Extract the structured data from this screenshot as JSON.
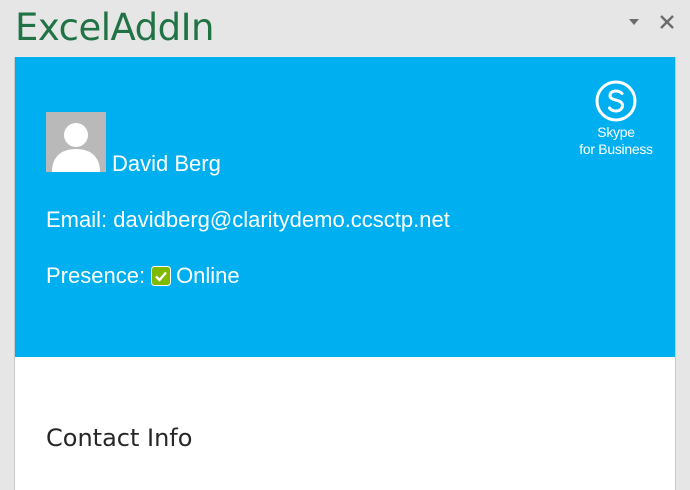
{
  "pane": {
    "title": "ExcelAddIn",
    "options_icon": "chevron-down-icon",
    "close_icon": "close-icon"
  },
  "profile": {
    "name": "David Berg",
    "avatar_icon": "person-placeholder-icon",
    "email_label": "Email:",
    "email_value": "davidberg@claritydemo.ccsctp.net",
    "presence_label": "Presence:",
    "presence_value": "Online",
    "presence_icon": "presence-online-check-icon"
  },
  "brand": {
    "logo_icon": "skype-icon",
    "line1": "Skype",
    "line2": "for Business"
  },
  "sections": {
    "contact_info_title": "Contact Info"
  },
  "colors": {
    "excel_green": "#217346",
    "skype_blue": "#00aff0",
    "presence_green": "#7fba00"
  }
}
